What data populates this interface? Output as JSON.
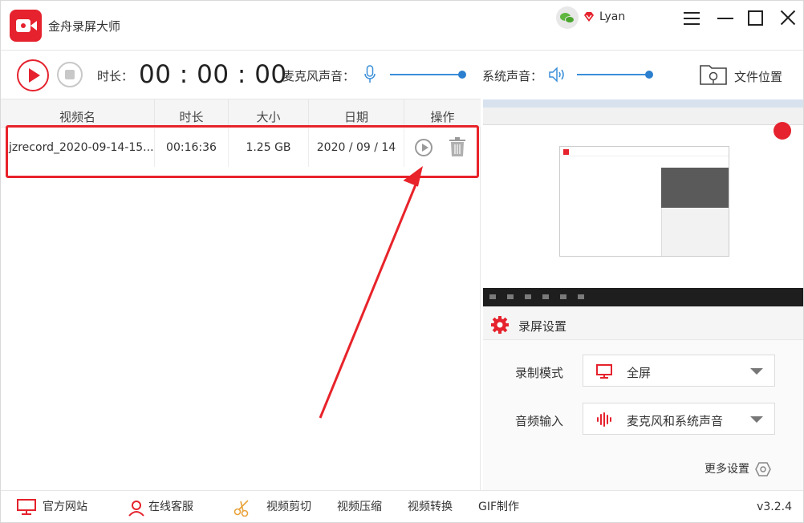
{
  "app": {
    "title": "金舟录屏大师",
    "username": "Lyan"
  },
  "toolbar": {
    "duration_label": "时长：",
    "timer": "00 : 00 : 00",
    "mic_label": "麦克风声音：",
    "mic_volume": 1.0,
    "system_label": "系统声音：",
    "system_volume": 1.0,
    "folder_label": "文件位置"
  },
  "table": {
    "columns": [
      "视频名",
      "时长",
      "大小",
      "日期",
      "操作"
    ],
    "rows": [
      {
        "name": "jzrecord_2020-09-14-15...",
        "duration": "00:16:36",
        "size": "1.25 GB",
        "date": "2020 / 09 / 14"
      }
    ]
  },
  "settings": {
    "title": "录屏设置",
    "mode_label": "录制模式",
    "mode_value": "全屏",
    "audio_label": "音频输入",
    "audio_value": "麦克风和系统声音",
    "more": "更多设置"
  },
  "footer": {
    "items": [
      "官方网站",
      "在线客服",
      "视频剪切",
      "视频压缩",
      "视频转换",
      "GIF制作"
    ],
    "version": "v3.2.4"
  },
  "colors": {
    "accent_red": "#e5222d",
    "slider_blue": "#3b8fd9",
    "annotation_red": "#e8232a"
  }
}
